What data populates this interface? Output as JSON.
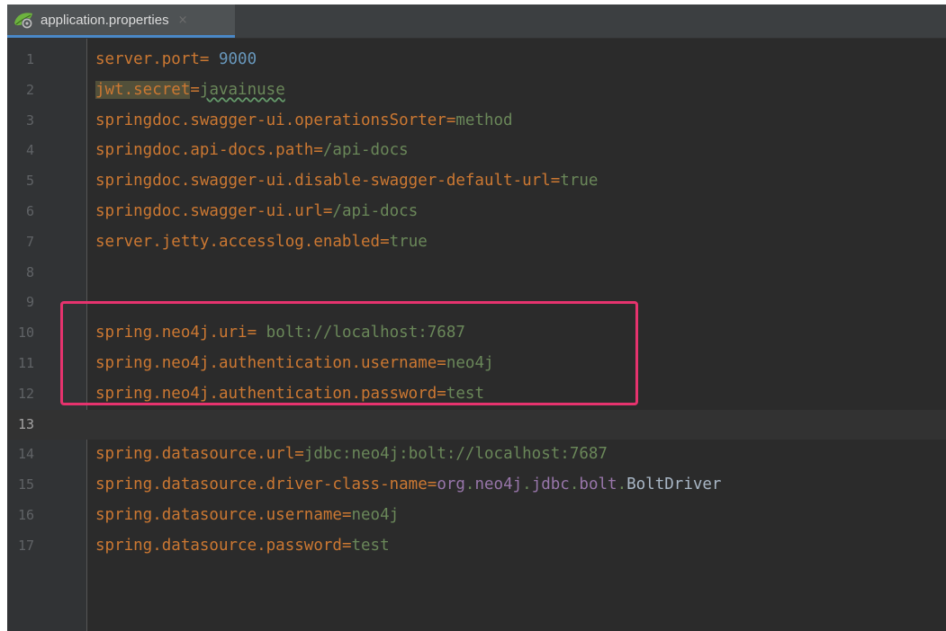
{
  "tab": {
    "filename": "application.properties",
    "close_glyph": "×",
    "icon": "spring-boot-leaf-icon"
  },
  "colors": {
    "editor_bg": "#2b2b2b",
    "keyword_orange": "#cc7832",
    "string_green": "#6a8759",
    "number_blue": "#6897bb",
    "highlight_border": "#e6336e",
    "tab_underline": "#4a88c7"
  },
  "current_line": 13,
  "lines": [
    {
      "n": "1",
      "key": "server.port",
      "sep": "= ",
      "value": "9000"
    },
    {
      "n": "2",
      "key": "jwt.secret",
      "sep": "=",
      "value": "javainuse"
    },
    {
      "n": "3",
      "key": "springdoc.swagger-ui.operationsSorter",
      "sep": "=",
      "value": "method"
    },
    {
      "n": "4",
      "key": "springdoc.api-docs.path",
      "sep": "=",
      "value": "/api-docs"
    },
    {
      "n": "5",
      "key": "springdoc.swagger-ui.disable-swagger-default-url",
      "sep": "=",
      "value": "true"
    },
    {
      "n": "6",
      "key": "springdoc.swagger-ui.url",
      "sep": "=",
      "value": "/api-docs"
    },
    {
      "n": "7",
      "key": "server.jetty.accesslog.enabled",
      "sep": "=",
      "value": "true"
    },
    {
      "n": "8",
      "key": "",
      "sep": "",
      "value": ""
    },
    {
      "n": "9",
      "key": "",
      "sep": "",
      "value": ""
    },
    {
      "n": "10",
      "key": "spring.neo4j.uri",
      "sep": "= ",
      "value": "bolt://localhost:7687"
    },
    {
      "n": "11",
      "key": "spring.neo4j.authentication.username",
      "sep": "=",
      "value": "neo4j"
    },
    {
      "n": "12",
      "key": "spring.neo4j.authentication.password",
      "sep": "=",
      "value": "test"
    },
    {
      "n": "13",
      "key": "",
      "sep": "",
      "value": ""
    },
    {
      "n": "14",
      "key": "spring.datasource.url",
      "sep": "=",
      "value": "jdbc:neo4j:bolt://localhost:7687"
    },
    {
      "n": "15",
      "key": "spring.datasource.driver-class-name",
      "sep": "=",
      "value_parts": [
        "org",
        ".",
        "neo4j",
        ".",
        "jdbc",
        ".",
        "bolt",
        ".",
        "BoltDriver"
      ]
    },
    {
      "n": "16",
      "key": "spring.datasource.username",
      "sep": "=",
      "value": "neo4j"
    },
    {
      "n": "17",
      "key": "spring.datasource.password",
      "sep": "=",
      "value": "test"
    }
  ]
}
